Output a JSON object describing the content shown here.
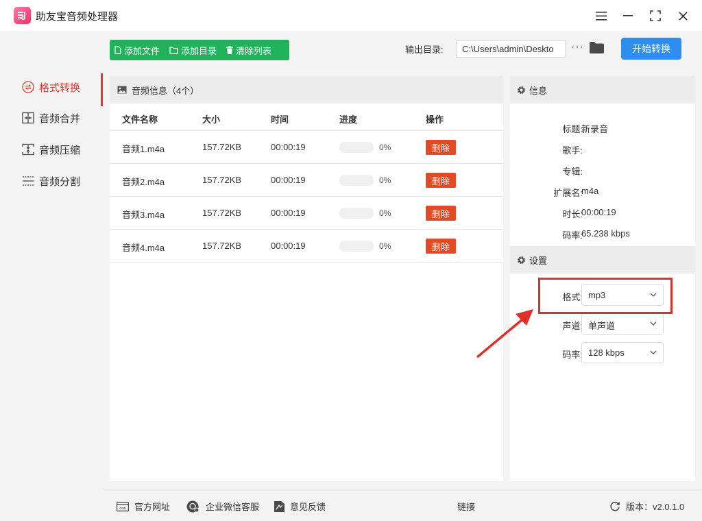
{
  "app": {
    "title": "助友宝音频处理器"
  },
  "sidebar": {
    "items": [
      {
        "label": "格式转换",
        "icon": "convert-icon",
        "active": true
      },
      {
        "label": "音频合并",
        "icon": "merge-icon"
      },
      {
        "label": "音频压缩",
        "icon": "compress-icon"
      },
      {
        "label": "音频分割",
        "icon": "split-icon"
      }
    ]
  },
  "toolbar": {
    "add_file": "添加文件",
    "add_dir": "添加目录",
    "clear_list": "清除列表",
    "output_label": "输出目录:",
    "output_path": "C:\\Users\\admin\\Deskto",
    "more": "···",
    "start": "开始转换"
  },
  "file_panel": {
    "title": "音频信息（4个）",
    "columns": [
      "文件名称",
      "大小",
      "时间",
      "进度",
      "操作"
    ],
    "rows": [
      {
        "name": "音频1.m4a",
        "size": "157.72KB",
        "time": "00:00:19",
        "progress": 0,
        "progress_text": "0%",
        "action": "删除"
      },
      {
        "name": "音频2.m4a",
        "size": "157.72KB",
        "time": "00:00:19",
        "progress": 0,
        "progress_text": "0%",
        "action": "删除"
      },
      {
        "name": "音频3.m4a",
        "size": "157.72KB",
        "time": "00:00:19",
        "progress": 0,
        "progress_text": "0%",
        "action": "删除"
      },
      {
        "name": "音频4.m4a",
        "size": "157.72KB",
        "time": "00:00:19",
        "progress": 0,
        "progress_text": "0%",
        "action": "删除"
      }
    ]
  },
  "info": {
    "title": "信息",
    "fields": [
      {
        "key": "标题:",
        "value": "新录音"
      },
      {
        "key": "歌手:",
        "value": ""
      },
      {
        "key": "专辑:",
        "value": ""
      },
      {
        "key": "扩展名:",
        "value": "m4a"
      },
      {
        "key": "时长:",
        "value": "00:00:19"
      },
      {
        "key": "码率:",
        "value": "65.238 kbps"
      }
    ]
  },
  "settings": {
    "title": "设置",
    "format_label": "格式:",
    "format_value": "mp3",
    "channel_label": "声道:",
    "channel_value": "单声道",
    "bitrate_label": "码率:",
    "bitrate_value": "128 kbps"
  },
  "footer": {
    "website": "官方网址",
    "wechat": "企业微信客服",
    "feedback": "意见反馈",
    "link": "链接",
    "version": "版本：v2.0.1.0"
  },
  "colors": {
    "accent": "#e03a2f",
    "green": "#21b35c",
    "blue": "#2d8ef0",
    "delete": "#e34a26"
  }
}
